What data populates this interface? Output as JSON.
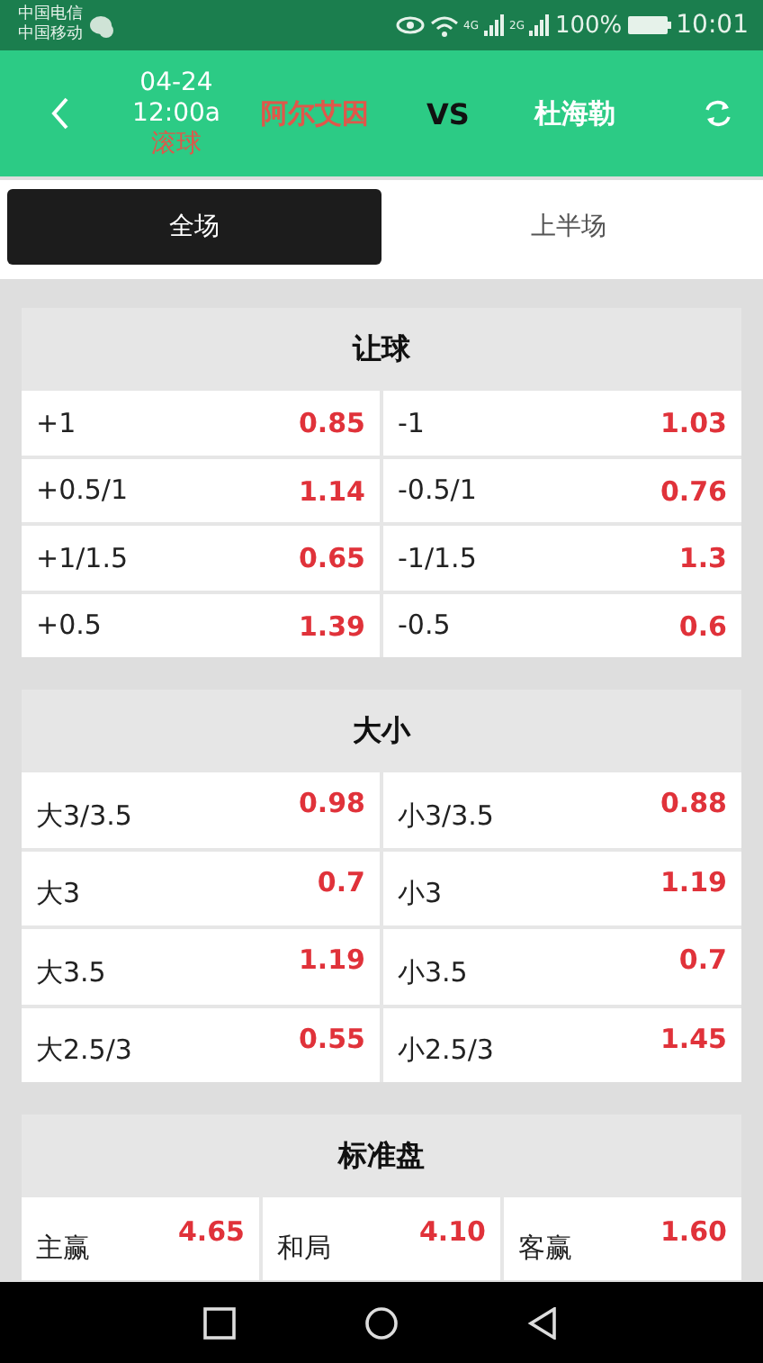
{
  "status_bar": {
    "carriers": [
      "中国电信",
      "中国移动"
    ],
    "network_labels": [
      "4G",
      "2G"
    ],
    "battery": "100%",
    "time": "10:01"
  },
  "header": {
    "date": "04-24",
    "time": "12:00a",
    "state": "滚球",
    "home": "阿尔艾因",
    "vs": "VS",
    "away": "杜海勒"
  },
  "tabs": [
    {
      "label": "全场",
      "selected": true
    },
    {
      "label": "上半场",
      "selected": false
    }
  ],
  "sections": [
    {
      "title": "让球",
      "rows": [
        [
          {
            "label": "+1",
            "odds": "0.85"
          },
          {
            "label": "-1",
            "odds": "1.03"
          }
        ],
        [
          {
            "label": "+0.5/1",
            "odds": "1.14"
          },
          {
            "label": "-0.5/1",
            "odds": "0.76"
          }
        ],
        [
          {
            "label": "+1/1.5",
            "odds": "0.65"
          },
          {
            "label": "-1/1.5",
            "odds": "1.3"
          }
        ],
        [
          {
            "label": "+0.5",
            "odds": "1.39"
          },
          {
            "label": "-0.5",
            "odds": "0.6"
          }
        ]
      ]
    },
    {
      "title": "大小",
      "rows": [
        [
          {
            "label": "大3/3.5",
            "odds": "0.98"
          },
          {
            "label": "小3/3.5",
            "odds": "0.88"
          }
        ],
        [
          {
            "label": "大3",
            "odds": "0.7"
          },
          {
            "label": "小3",
            "odds": "1.19"
          }
        ],
        [
          {
            "label": "大3.5",
            "odds": "1.19"
          },
          {
            "label": "小3.5",
            "odds": "0.7"
          }
        ],
        [
          {
            "label": "大2.5/3",
            "odds": "0.55"
          },
          {
            "label": "小2.5/3",
            "odds": "1.45"
          }
        ]
      ]
    },
    {
      "title": "标准盘",
      "rows": [
        [
          {
            "label": "主赢",
            "odds": "4.65"
          },
          {
            "label": "和局",
            "odds": "4.10"
          },
          {
            "label": "客赢",
            "odds": "1.60"
          }
        ]
      ]
    }
  ]
}
